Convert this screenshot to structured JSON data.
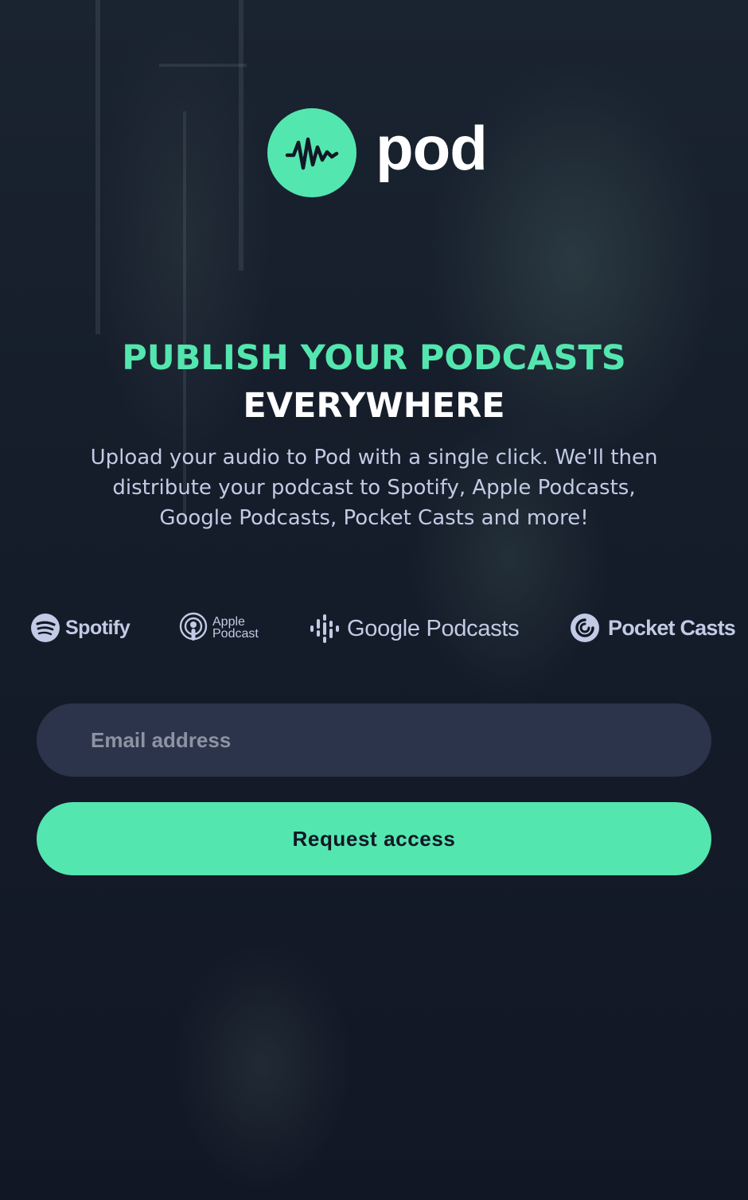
{
  "brand": {
    "name": "pod",
    "logo_icon": "waveform-icon",
    "accent_color": "#54e6af",
    "background_color": "#121725"
  },
  "hero": {
    "headline_green": "PUBLISH YOUR PODCASTS",
    "headline_white": "EVERYWHERE",
    "description": "Upload your audio to Pod with a single click. We'll then distribute your podcast to Spotify, Apple Podcasts, Google Podcasts, Pocket Casts and more!"
  },
  "platforms": {
    "spotify": {
      "label": "Spotify",
      "icon": "spotify-icon"
    },
    "apple": {
      "label_line1": "Apple",
      "label_line2": "Podcast",
      "icon": "apple-podcast-icon"
    },
    "google": {
      "label": "Google Podcasts",
      "icon": "google-podcasts-icon"
    },
    "pocket": {
      "label": "Pocket Casts",
      "icon": "pocket-casts-icon"
    }
  },
  "form": {
    "email_placeholder": "Email address",
    "submit_label": "Request access"
  }
}
